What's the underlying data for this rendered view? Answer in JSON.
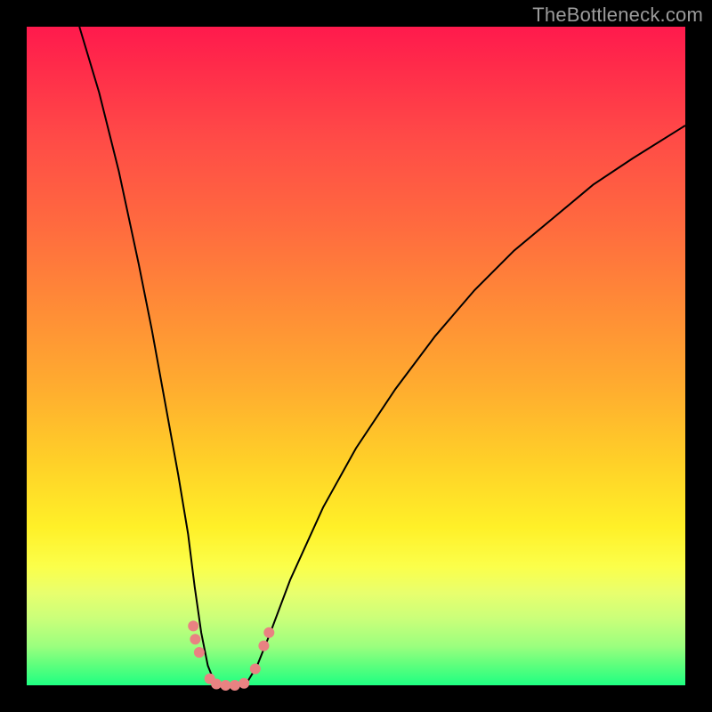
{
  "watermark": "TheBottleneck.com",
  "colors": {
    "frame": "#000000",
    "curve_stroke": "#000000",
    "markers": "#e98282",
    "gradient_top": "#ff1a4d",
    "gradient_bottom": "#1fff82"
  },
  "chart_data": {
    "type": "line",
    "title": "",
    "xlabel": "",
    "ylabel": "",
    "xlim": [
      0,
      100
    ],
    "ylim": [
      0,
      100
    ],
    "curve_points": [
      {
        "x": 8,
        "y": 100
      },
      {
        "x": 11,
        "y": 90
      },
      {
        "x": 14,
        "y": 78
      },
      {
        "x": 17,
        "y": 64
      },
      {
        "x": 19,
        "y": 54
      },
      {
        "x": 21,
        "y": 43
      },
      {
        "x": 23,
        "y": 32
      },
      {
        "x": 24.5,
        "y": 23
      },
      {
        "x": 25.5,
        "y": 15
      },
      {
        "x": 26.5,
        "y": 8
      },
      {
        "x": 27.5,
        "y": 3
      },
      {
        "x": 28.5,
        "y": 0.5
      },
      {
        "x": 30,
        "y": 0
      },
      {
        "x": 32,
        "y": 0
      },
      {
        "x": 33.5,
        "y": 0.5
      },
      {
        "x": 35,
        "y": 3
      },
      {
        "x": 37,
        "y": 8
      },
      {
        "x": 40,
        "y": 16
      },
      {
        "x": 45,
        "y": 27
      },
      {
        "x": 50,
        "y": 36
      },
      {
        "x": 56,
        "y": 45
      },
      {
        "x": 62,
        "y": 53
      },
      {
        "x": 68,
        "y": 60
      },
      {
        "x": 74,
        "y": 66
      },
      {
        "x": 80,
        "y": 71
      },
      {
        "x": 86,
        "y": 76
      },
      {
        "x": 92,
        "y": 80
      },
      {
        "x": 100,
        "y": 85
      }
    ],
    "markers": [
      {
        "x": 25.3,
        "y": 9,
        "r": 6
      },
      {
        "x": 25.6,
        "y": 7,
        "r": 6
      },
      {
        "x": 26.2,
        "y": 5,
        "r": 6
      },
      {
        "x": 27.8,
        "y": 1,
        "r": 6
      },
      {
        "x": 28.8,
        "y": 0.2,
        "r": 6
      },
      {
        "x": 30.2,
        "y": 0,
        "r": 6
      },
      {
        "x": 31.6,
        "y": 0,
        "r": 6
      },
      {
        "x": 33.0,
        "y": 0.3,
        "r": 6
      },
      {
        "x": 34.7,
        "y": 2.5,
        "r": 6
      },
      {
        "x": 36.0,
        "y": 6,
        "r": 6
      },
      {
        "x": 36.8,
        "y": 8,
        "r": 6
      }
    ]
  }
}
